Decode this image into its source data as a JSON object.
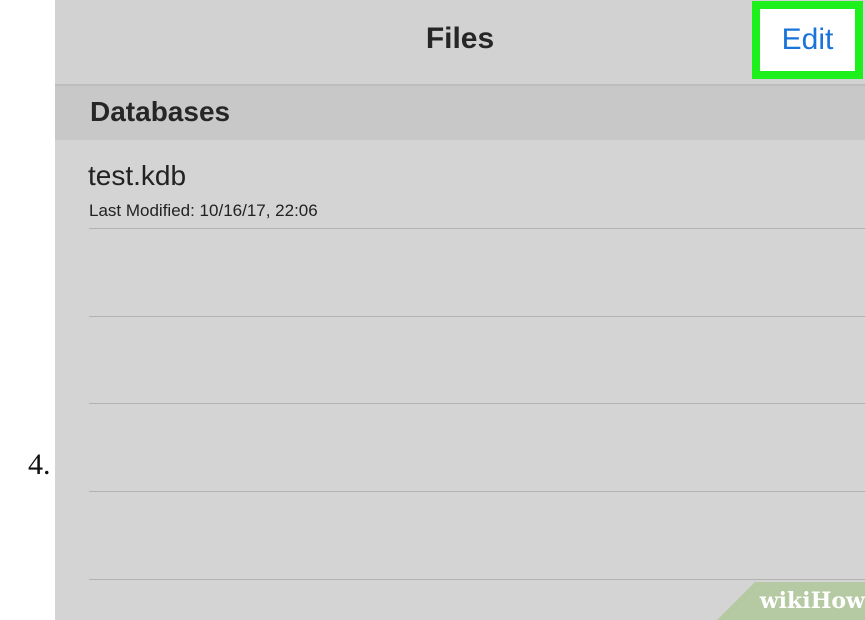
{
  "step": {
    "number": "4."
  },
  "nav": {
    "title": "Files",
    "edit_label": "Edit"
  },
  "section": {
    "title": "Databases"
  },
  "files": [
    {
      "name": "test.kdb",
      "meta": "Last Modified: 10/16/17, 22:06"
    }
  ],
  "watermark": {
    "text": "wikiHow"
  },
  "colors": {
    "highlight": "#1ef01e",
    "link": "#1a73d9",
    "background": "#d4d4d4"
  }
}
